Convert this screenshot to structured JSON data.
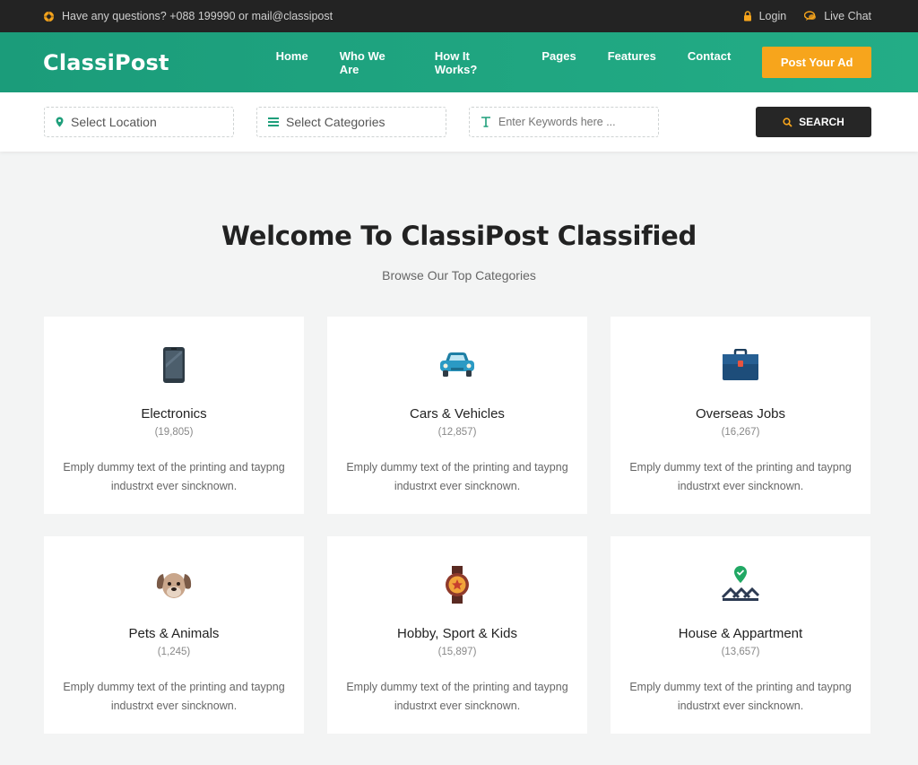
{
  "topbar": {
    "contact_text": "Have any questions? +088 199990 or mail@classipost",
    "login_label": "Login",
    "chat_label": "Live Chat"
  },
  "header": {
    "logo": "ClassiPost",
    "menu": [
      "Home",
      "Who We Are",
      "How It Works?",
      "Pages",
      "Features",
      "Contact"
    ],
    "post_ad_label": "Post Your Ad"
  },
  "search": {
    "location_label": "Select Location",
    "category_label": "Select Categories",
    "keyword_placeholder": "Enter Keywords here ...",
    "button_label": "SEARCH"
  },
  "main": {
    "title": "Welcome To ClassiPost Classified",
    "subtitle": "Browse Our Top Categories"
  },
  "categories": [
    {
      "title": "Electronics",
      "count": "(19,805)",
      "desc": "Emply dummy text of the printing and taypng industrxt ever sincknown.",
      "icon": "smartphone-icon"
    },
    {
      "title": "Cars & Vehicles",
      "count": "(12,857)",
      "desc": "Emply dummy text of the printing and taypng industrxt ever sincknown.",
      "icon": "car-icon"
    },
    {
      "title": "Overseas Jobs",
      "count": "(16,267)",
      "desc": "Emply dummy text of the printing and taypng industrxt ever sincknown.",
      "icon": "briefcase-icon"
    },
    {
      "title": "Pets & Animals",
      "count": "(1,245)",
      "desc": "Emply dummy text of the printing and taypng industrxt ever sincknown.",
      "icon": "dog-icon"
    },
    {
      "title": "Hobby, Sport & Kids",
      "count": "(15,897)",
      "desc": "Emply dummy text of the printing and taypng industrxt ever sincknown.",
      "icon": "watch-icon"
    },
    {
      "title": "House & Appartment",
      "count": "(13,657)",
      "desc": "Emply dummy text of the printing and taypng industrxt ever sincknown.",
      "icon": "house-location-icon"
    }
  ],
  "colors": {
    "brand_green": "#1f a57f",
    "accent_orange": "#f7a51c",
    "dark": "#232323"
  }
}
